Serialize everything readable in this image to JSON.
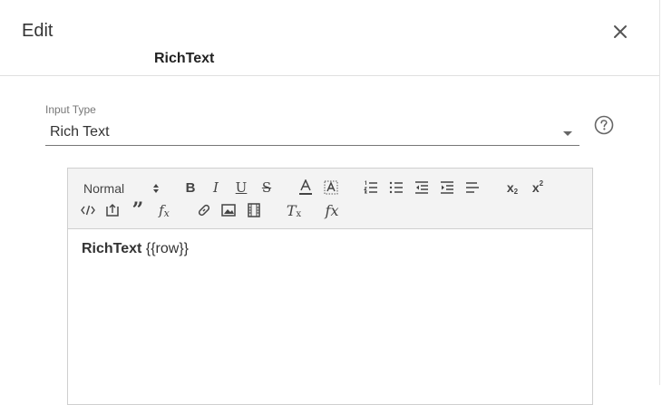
{
  "dialog": {
    "title": "Edit",
    "subtitle": "RichText"
  },
  "input_type": {
    "label": "Input Type",
    "value": "Rich Text"
  },
  "toolbar": {
    "format_value": "Normal",
    "icons": [
      "align-icon",
      "bold-icon",
      "italic-icon",
      "underline-icon",
      "strike-icon",
      "font-color-icon",
      "background-color-icon",
      "ordered-list-icon",
      "bullet-list-icon",
      "outdent-icon",
      "indent-icon",
      "align-left-icon",
      "subscript-icon",
      "superscript-icon",
      "code-icon",
      "image-upload-icon",
      "blockquote-icon",
      "formula-icon",
      "link-icon",
      "image-icon",
      "video-icon",
      "clean-icon",
      "function-icon"
    ]
  },
  "editor": {
    "bold_text": "RichText",
    "template_text": "{{row}}"
  },
  "colors": {
    "toolbar_bg": "#f3f3f3",
    "border": "#cfcfcf",
    "text": "#333333"
  }
}
